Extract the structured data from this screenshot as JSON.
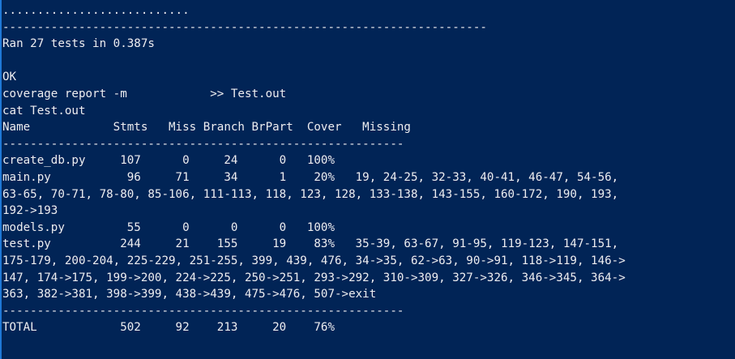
{
  "terminal": {
    "lines": [
      "...........................",
      "----------------------------------------------------------------------",
      "Ran 27 tests in 0.387s",
      "",
      "OK",
      "coverage report -m            >> Test.out",
      "cat Test.out",
      "Name            Stmts   Miss Branch BrPart  Cover   Missing",
      "----------------------------------------------------------",
      "create_db.py     107      0     24      0   100%",
      "main.py           96     71     34      1    20%   19, 24-25, 32-33, 40-41, 46-47, 54-56,",
      "63-65, 70-71, 78-80, 85-106, 111-113, 118, 123, 128, 133-138, 143-155, 160-172, 190, 193,",
      "192->193",
      "models.py         55      0      0      0   100%",
      "test.py          244     21    155     19    83%   35-39, 63-67, 91-95, 119-123, 147-151,",
      "175-179, 200-204, 225-229, 251-255, 399, 439, 476, 34->35, 62->63, 90->91, 118->119, 146->",
      "147, 174->175, 199->200, 224->225, 250->251, 293->292, 310->309, 327->326, 346->345, 364->",
      "363, 382->381, 398->399, 438->439, 475->476, 507->exit",
      "----------------------------------------------------------",
      "TOTAL            502     92    213     20    76%"
    ]
  },
  "colors": {
    "background": "#012456",
    "foreground": "#eeedf0",
    "border": "#1f78d6"
  }
}
